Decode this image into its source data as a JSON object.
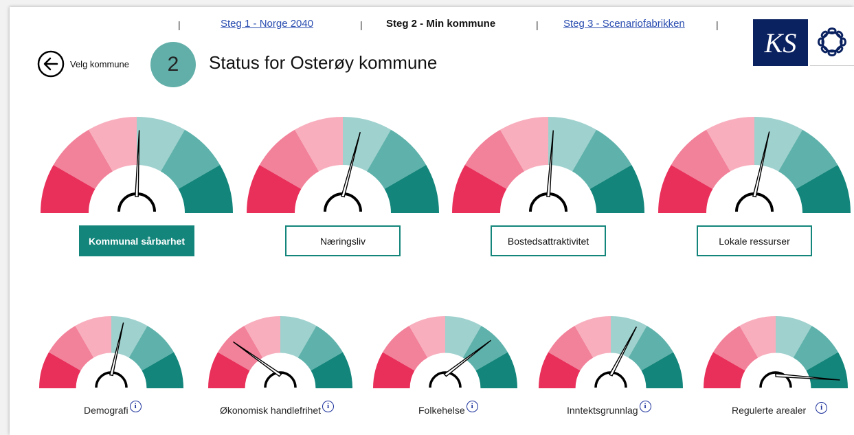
{
  "nav": {
    "step1": "Steg 1 - Norge 2040",
    "step2": "Steg 2 - Min kommune",
    "step3": "Steg 3 - Scenariofabrikken",
    "separator": "|"
  },
  "logo": {
    "text": "KS",
    "ring_icon": "chain-ring-logo"
  },
  "back": {
    "label": "Velg kommune",
    "icon": "arrow-left-circle-icon"
  },
  "step": {
    "number": "2"
  },
  "title": "Status for Osterøy kommune",
  "colors": {
    "red_dark": "#e8305a",
    "red_mid": "#f2819a",
    "red_light": "#f8aebd",
    "teal_light": "#9fd1ce",
    "teal_mid": "#5fb2ab",
    "teal_dark": "#13857b",
    "button_border": "#13857b",
    "info_blue": "#1a2f9a"
  },
  "main_gauges": [
    {
      "label": "Kommunal sårbarhet",
      "value": 0.51,
      "active": true
    },
    {
      "label": "Næringsliv",
      "value": 0.57,
      "active": false
    },
    {
      "label": "Bostedsattraktivitet",
      "value": 0.52,
      "active": false
    },
    {
      "label": "Lokale ressurser",
      "value": 0.56,
      "active": false
    }
  ],
  "sub_gauges": [
    {
      "label": "Demografi",
      "value": 0.56,
      "info": "i"
    },
    {
      "label": "Økonomisk handlefrihet",
      "value": 0.24,
      "info": "i"
    },
    {
      "label": "Folkehelse",
      "value": 0.75,
      "info": "i"
    },
    {
      "label": "Inntektsgrunnlag",
      "value": 0.63,
      "info": "i"
    },
    {
      "label": "Regulerte arealer",
      "value": 0.97,
      "info": "i"
    }
  ]
}
